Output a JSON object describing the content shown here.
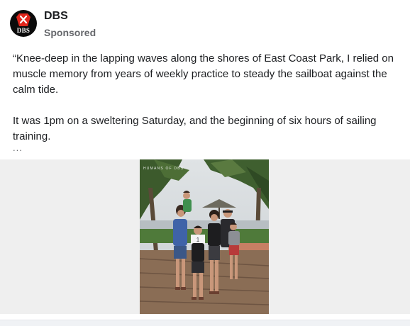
{
  "post": {
    "advertiser": "DBS",
    "avatar_text": "DBS",
    "label": "Sponsored",
    "paragraphs": [
      "“Knee-deep in the lapping waves along the shores of East Coast Park, I relied on muscle memory from years of weekly practice to steady the sailboat against the calm tide.",
      "It was 1pm on a sweltering Saturday, and the beginning of six hours of sailing training."
    ],
    "more": "..."
  },
  "media": {
    "watermark": "HUMANS OF DBS",
    "paper_sign": "1"
  },
  "colors": {
    "brand_red": "#e1261c",
    "avatar_bg": "#0b0b0b",
    "sponsored_gray": "#65676b",
    "media_bg": "#efefef"
  }
}
